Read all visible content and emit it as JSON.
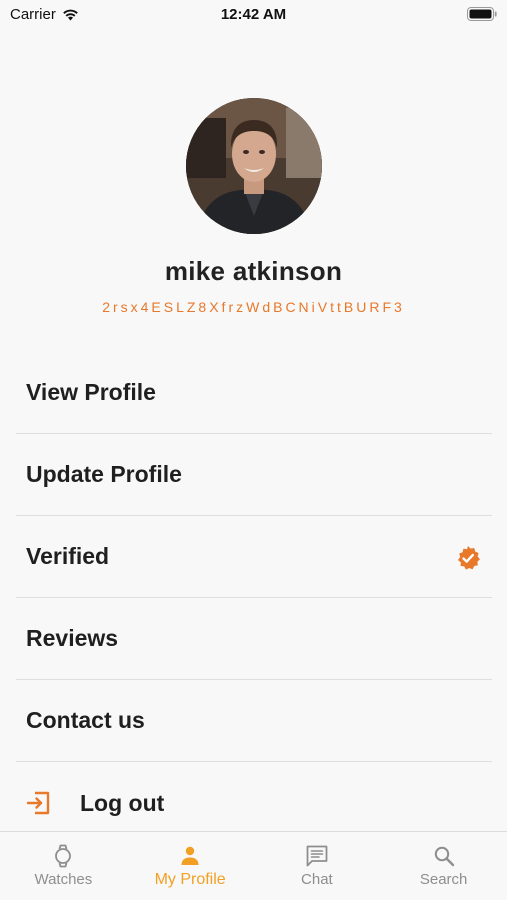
{
  "status_bar": {
    "carrier": "Carrier",
    "time": "12:42 AM"
  },
  "profile": {
    "name": "mike atkinson",
    "user_id": "2rsx4ESLZ8XfrzWdBCNiVttBURF3"
  },
  "menu": {
    "items": [
      {
        "label": "View Profile"
      },
      {
        "label": "Update Profile"
      },
      {
        "label": "Verified",
        "icon": "verified-badge-icon"
      },
      {
        "label": "Reviews"
      },
      {
        "label": "Contact us"
      },
      {
        "label": "Log out",
        "icon": "logout-icon"
      }
    ]
  },
  "tab_bar": {
    "tabs": [
      {
        "label": "Watches",
        "icon": "watch-icon"
      },
      {
        "label": "My Profile",
        "icon": "person-icon",
        "active": true
      },
      {
        "label": "Chat",
        "icon": "chat-icon"
      },
      {
        "label": "Search",
        "icon": "search-icon"
      }
    ]
  },
  "colors": {
    "accent": "#e8782a",
    "tab_active": "#f2a024",
    "tab_inactive": "#8e8e8e",
    "background": "#f8f8f8"
  }
}
